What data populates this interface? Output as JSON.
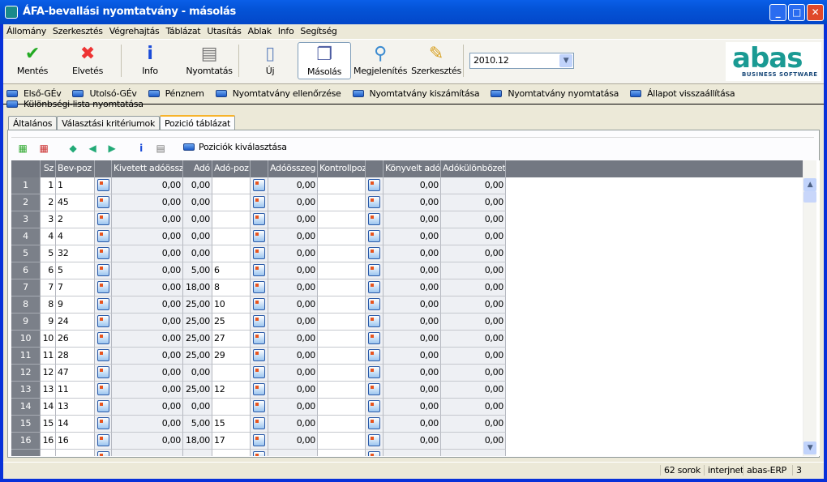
{
  "window": {
    "title": "ÁFA-bevallási nyomtatvány - másolás"
  },
  "menu": [
    "Állomány",
    "Szerkesztés",
    "Végrehajtás",
    "Táblázat",
    "Utasítás",
    "Ablak",
    "Info",
    "Segítség"
  ],
  "toolbar": {
    "buttons": [
      {
        "label": "Mentés",
        "icon": "checkmark-icon"
      },
      {
        "label": "Elvetés",
        "icon": "x-icon"
      },
      {
        "label": "Info",
        "icon": "info-icon"
      },
      {
        "label": "Nyomtatás",
        "icon": "printer-icon"
      },
      {
        "label": "Új",
        "icon": "new-document-icon"
      },
      {
        "label": "Másolás",
        "icon": "copy-icon"
      },
      {
        "label": "Megjelenítés",
        "icon": "magnifier-icon"
      },
      {
        "label": "Szerkesztés",
        "icon": "edit-icon"
      }
    ],
    "period": "2010.12",
    "logo": {
      "text": "abas",
      "sub": "BUSINESS SOFTWARE"
    }
  },
  "actions": [
    "Első-GÉv",
    "Utolsó-GÉv",
    "Pénznem",
    "Nyomtatvány ellenőrzése",
    "Nyomtatvány kiszámítása",
    "Nyomtatvány nyomtatása",
    "Állapot visszaállítása",
    "Különbségi-lista nyomtatása"
  ],
  "tabs": [
    "Általános",
    "Választási kritériumok",
    "Pozició táblázat"
  ],
  "active_tab": "Pozició táblázat",
  "subtoolbar": {
    "select_label": "Poziciók kiválasztása"
  },
  "grid": {
    "columns": [
      "",
      "Sz",
      "Bev-poz",
      "",
      "Kivetett adóössz",
      "Adó",
      "Adó-poz",
      "",
      "Adóösszeg",
      "Kontrollpoz",
      "",
      "Könyvelt adó",
      "Adókülönbözet"
    ],
    "rows": [
      [
        "1",
        "1",
        "1",
        "0,00",
        "0,00",
        "",
        "0,00",
        "",
        "0,00",
        "0,00"
      ],
      [
        "2",
        "2",
        "45",
        "0,00",
        "0,00",
        "",
        "0,00",
        "",
        "0,00",
        "0,00"
      ],
      [
        "3",
        "3",
        "2",
        "0,00",
        "0,00",
        "",
        "0,00",
        "",
        "0,00",
        "0,00"
      ],
      [
        "4",
        "4",
        "4",
        "0,00",
        "0,00",
        "",
        "0,00",
        "",
        "0,00",
        "0,00"
      ],
      [
        "5",
        "5",
        "32",
        "0,00",
        "0,00",
        "",
        "0,00",
        "",
        "0,00",
        "0,00"
      ],
      [
        "6",
        "6",
        "5",
        "0,00",
        "5,00",
        "6",
        "0,00",
        "",
        "0,00",
        "0,00"
      ],
      [
        "7",
        "7",
        "7",
        "0,00",
        "18,00",
        "8",
        "0,00",
        "",
        "0,00",
        "0,00"
      ],
      [
        "8",
        "8",
        "9",
        "0,00",
        "25,00",
        "10",
        "0,00",
        "",
        "0,00",
        "0,00"
      ],
      [
        "9",
        "9",
        "24",
        "0,00",
        "25,00",
        "25",
        "0,00",
        "",
        "0,00",
        "0,00"
      ],
      [
        "10",
        "10",
        "26",
        "0,00",
        "25,00",
        "27",
        "0,00",
        "",
        "0,00",
        "0,00"
      ],
      [
        "11",
        "11",
        "28",
        "0,00",
        "25,00",
        "29",
        "0,00",
        "",
        "0,00",
        "0,00"
      ],
      [
        "12",
        "12",
        "47",
        "0,00",
        "0,00",
        "",
        "0,00",
        "",
        "0,00",
        "0,00"
      ],
      [
        "13",
        "13",
        "11",
        "0,00",
        "25,00",
        "12",
        "0,00",
        "",
        "0,00",
        "0,00"
      ],
      [
        "14",
        "14",
        "13",
        "0,00",
        "0,00",
        "",
        "0,00",
        "",
        "0,00",
        "0,00"
      ],
      [
        "15",
        "15",
        "14",
        "0,00",
        "5,00",
        "15",
        "0,00",
        "",
        "0,00",
        "0,00"
      ],
      [
        "16",
        "16",
        "16",
        "0,00",
        "18,00",
        "17",
        "0,00",
        "",
        "0,00",
        "0,00"
      ]
    ]
  },
  "status": {
    "rows": "62 sorok",
    "server": "interjnet",
    "system": "abas-ERP",
    "count": "3"
  }
}
